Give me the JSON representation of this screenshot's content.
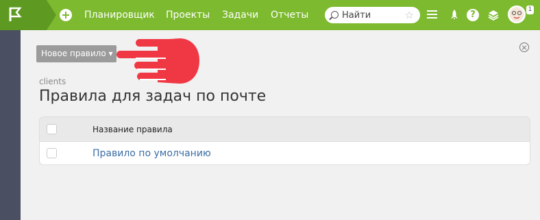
{
  "nav": {
    "items": [
      {
        "label": "Планировщик"
      },
      {
        "label": "Проекты"
      },
      {
        "label": "Задачи"
      },
      {
        "label": "Отчеты"
      }
    ]
  },
  "search": {
    "placeholder": "Найти"
  },
  "notifications": {
    "count": "1"
  },
  "toolbar": {
    "new_rule_label": "Новое правило ▾"
  },
  "page": {
    "project": "clients",
    "title": "Правила для задач по почте"
  },
  "table": {
    "header": "Название правила",
    "rows": [
      {
        "name": "Правило по умолчанию"
      }
    ]
  },
  "colors": {
    "topbar": "#7dba2f",
    "logo_bg": "#5e9a22",
    "rail": "#4a4f62",
    "link": "#3b6ea5",
    "pointer_hand": "#f03844"
  }
}
